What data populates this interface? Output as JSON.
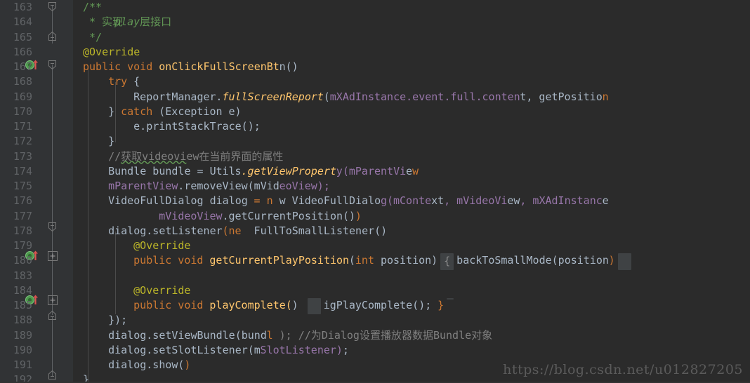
{
  "editor": {
    "theme": "darcula",
    "background": "#2b2b2b",
    "gutter_background": "#313335",
    "line_number_color": "#606366",
    "default_text_color": "#a9b7c6",
    "colors": {
      "keyword": "#cc7832",
      "annotation": "#bbb529",
      "comment": "#808080",
      "javadoc": "#629755",
      "field": "#9876aa",
      "method": "#ffc66d",
      "folded_background": "#3f4244",
      "watermark": "#5b5b5b"
    },
    "first_visible_line": 163,
    "last_visible_line": 192,
    "folded_line_range": "186-187"
  },
  "watermark": {
    "text": "https://blog.csdn.net/u012827205"
  },
  "gutter_icons": [
    {
      "line": 167,
      "name": "implementing-method-marker",
      "glyph": "O↑",
      "tooltip_kind": "overriding-method"
    },
    {
      "line": 180,
      "name": "implementing-method-marker",
      "glyph": "O↑",
      "tooltip_kind": "overriding-method"
    },
    {
      "line": 185,
      "name": "implementing-method-marker",
      "glyph": "O↑",
      "tooltip_kind": "overriding-method"
    }
  ],
  "fold_markers": [
    {
      "line": 163,
      "type": "region-start",
      "symbol": "collapse"
    },
    {
      "line": 165,
      "type": "region-end",
      "symbol": "collapse"
    },
    {
      "line": 167,
      "type": "region-start",
      "symbol": "collapse"
    },
    {
      "line": 178,
      "type": "region-start",
      "symbol": "collapse"
    },
    {
      "line": 180,
      "type": "collapsed",
      "symbol": "expand"
    },
    {
      "line": 185,
      "type": "collapsed",
      "symbol": "expand"
    },
    {
      "line": 188,
      "type": "region-end",
      "symbol": "collapse"
    },
    {
      "line": 192,
      "type": "region-end",
      "symbol": "collapse"
    }
  ],
  "lines": [
    {
      "n": "163",
      "text": "/**"
    },
    {
      "n": "164",
      "text": " * 实现play层接口"
    },
    {
      "n": "165",
      "text": " */"
    },
    {
      "n": "166",
      "text": "@Override"
    },
    {
      "n": "167",
      "text": "public void onClickFullScreenBtn() {"
    },
    {
      "n": "168",
      "text": "    try {"
    },
    {
      "n": "169",
      "text": "        ReportManager.fullScreenReport(mXAdInstance.event.full.content, getPosition());"
    },
    {
      "n": "170",
      "text": "    } catch (Exception e) {"
    },
    {
      "n": "171",
      "text": "        e.printStackTrace();"
    },
    {
      "n": "172",
      "text": "    }"
    },
    {
      "n": "173",
      "text": "    //获取videoview在当前界面的属性"
    },
    {
      "n": "174",
      "text": "    Bundle bundle = Utils.getViewProperty(mParentView);"
    },
    {
      "n": "175",
      "text": "    mParentView.removeView(mVideoView);"
    },
    {
      "n": "176",
      "text": "    VideoFullDialog dialog = new VideoFullDialog(mContext, mVideoView, mXAdInstance,"
    },
    {
      "n": "177",
      "text": "            mVideoView.getCurrentPosition());"
    },
    {
      "n": "178",
      "text": "    dialog.setListener(new FullToSmallListener() {"
    },
    {
      "n": "179",
      "text": "        @Override"
    },
    {
      "n": "180",
      "text": "        public void getCurrentPlayPosition(int position) { backToSmallMode(position); }"
    },
    {
      "n": "183",
      "text": ""
    },
    {
      "n": "184",
      "text": "        @Override"
    },
    {
      "n": "185",
      "text": "        public void playComplete() { bigPlayComplete(); }"
    },
    {
      "n": "188",
      "text": "    });"
    },
    {
      "n": "189",
      "text": "    dialog.setViewBundle(bundle); //为Dialog设置播放器数据Bundle对象"
    },
    {
      "n": "190",
      "text": "    dialog.setSlotListener(mSlotListener);"
    },
    {
      "n": "191",
      "text": "    dialog.show();"
    },
    {
      "n": "192",
      "text": "}"
    }
  ]
}
